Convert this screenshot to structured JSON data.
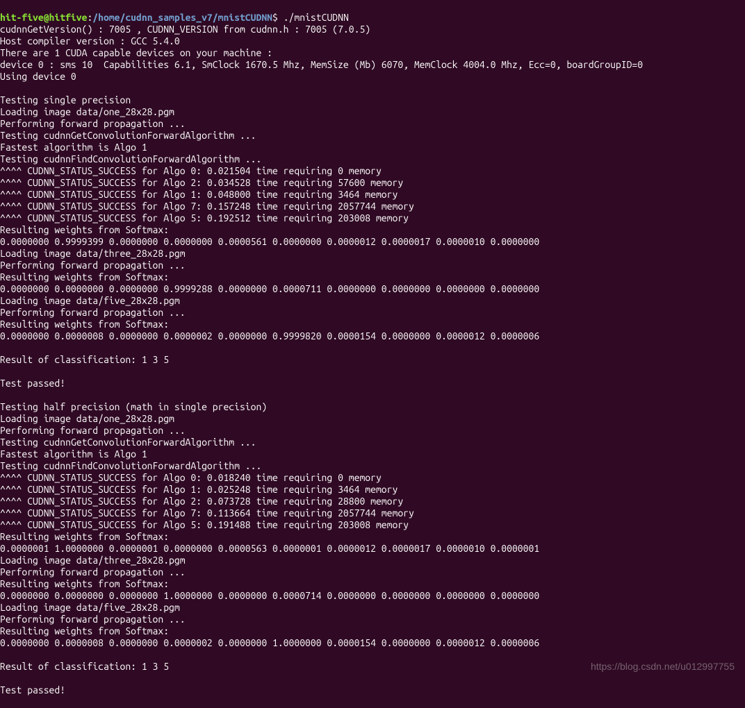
{
  "prompt": {
    "user": "hit-five@hitfive",
    "path": "/home/cudnn_samples_v7/mnistCUDNN",
    "command": "./mnistCUDNN"
  },
  "lines": [
    "cudnnGetVersion() : 7005 , CUDNN_VERSION from cudnn.h : 7005 (7.0.5)",
    "Host compiler version : GCC 5.4.0",
    "There are 1 CUDA capable devices on your machine :",
    "device 0 : sms 10  Capabilities 6.1, SmClock 1670.5 Mhz, MemSize (Mb) 6070, MemClock 4004.0 Mhz, Ecc=0, boardGroupID=0",
    "Using device 0",
    "",
    "Testing single precision",
    "Loading image data/one_28x28.pgm",
    "Performing forward propagation ...",
    "Testing cudnnGetConvolutionForwardAlgorithm ...",
    "Fastest algorithm is Algo 1",
    "Testing cudnnFindConvolutionForwardAlgorithm ...",
    "^^^^ CUDNN_STATUS_SUCCESS for Algo 0: 0.021504 time requiring 0 memory",
    "^^^^ CUDNN_STATUS_SUCCESS for Algo 2: 0.034528 time requiring 57600 memory",
    "^^^^ CUDNN_STATUS_SUCCESS for Algo 1: 0.048000 time requiring 3464 memory",
    "^^^^ CUDNN_STATUS_SUCCESS for Algo 7: 0.157248 time requiring 2057744 memory",
    "^^^^ CUDNN_STATUS_SUCCESS for Algo 5: 0.192512 time requiring 203008 memory",
    "Resulting weights from Softmax:",
    "0.0000000 0.9999399 0.0000000 0.0000000 0.0000561 0.0000000 0.0000012 0.0000017 0.0000010 0.0000000",
    "Loading image data/three_28x28.pgm",
    "Performing forward propagation ...",
    "Resulting weights from Softmax:",
    "0.0000000 0.0000000 0.0000000 0.9999288 0.0000000 0.0000711 0.0000000 0.0000000 0.0000000 0.0000000",
    "Loading image data/five_28x28.pgm",
    "Performing forward propagation ...",
    "Resulting weights from Softmax:",
    "0.0000000 0.0000008 0.0000000 0.0000002 0.0000000 0.9999820 0.0000154 0.0000000 0.0000012 0.0000006",
    "",
    "Result of classification: 1 3 5",
    "",
    "Test passed!",
    "",
    "Testing half precision (math in single precision)",
    "Loading image data/one_28x28.pgm",
    "Performing forward propagation ...",
    "Testing cudnnGetConvolutionForwardAlgorithm ...",
    "Fastest algorithm is Algo 1",
    "Testing cudnnFindConvolutionForwardAlgorithm ...",
    "^^^^ CUDNN_STATUS_SUCCESS for Algo 0: 0.018240 time requiring 0 memory",
    "^^^^ CUDNN_STATUS_SUCCESS for Algo 1: 0.025248 time requiring 3464 memory",
    "^^^^ CUDNN_STATUS_SUCCESS for Algo 2: 0.073728 time requiring 28800 memory",
    "^^^^ CUDNN_STATUS_SUCCESS for Algo 7: 0.113664 time requiring 2057744 memory",
    "^^^^ CUDNN_STATUS_SUCCESS for Algo 5: 0.191488 time requiring 203008 memory",
    "Resulting weights from Softmax:",
    "0.0000001 1.0000000 0.0000001 0.0000000 0.0000563 0.0000001 0.0000012 0.0000017 0.0000010 0.0000001",
    "Loading image data/three_28x28.pgm",
    "Performing forward propagation ...",
    "Resulting weights from Softmax:",
    "0.0000000 0.0000000 0.0000000 1.0000000 0.0000000 0.0000714 0.0000000 0.0000000 0.0000000 0.0000000",
    "Loading image data/five_28x28.pgm",
    "Performing forward propagation ...",
    "Resulting weights from Softmax:",
    "0.0000000 0.0000008 0.0000000 0.0000002 0.0000000 1.0000000 0.0000154 0.0000000 0.0000012 0.0000006",
    "",
    "Result of classification: 1 3 5",
    "",
    "Test passed!"
  ],
  "watermark": "https://blog.csdn.net/u012997755"
}
